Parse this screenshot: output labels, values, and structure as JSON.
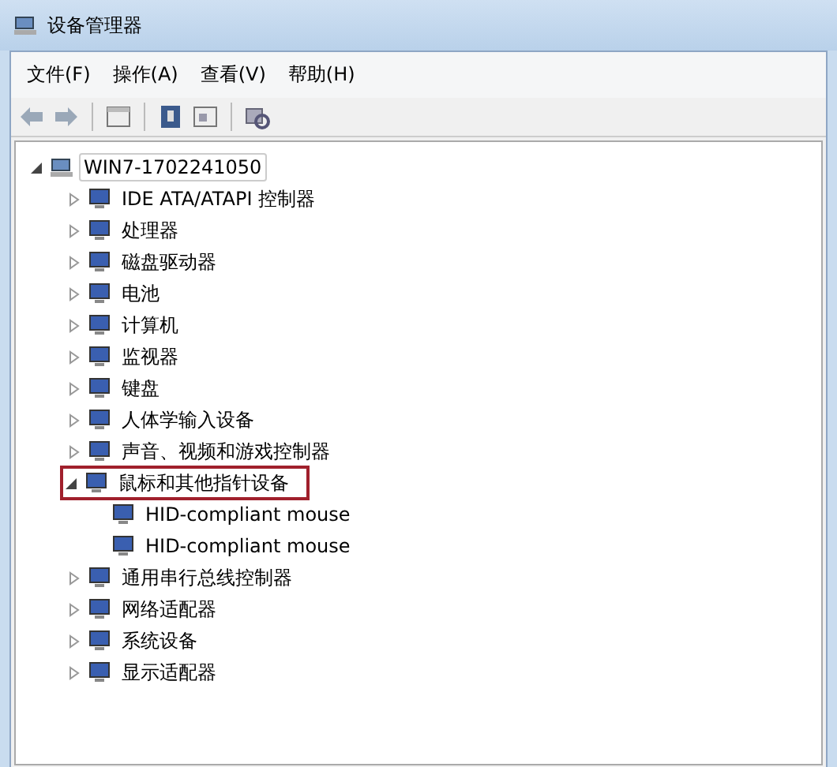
{
  "window": {
    "title": "设备管理器"
  },
  "menu": [
    "文件(F)",
    "操作(A)",
    "查看(V)",
    "帮助(H)"
  ],
  "tree": {
    "label": "WIN7-1702241050",
    "expanded": true,
    "selected": true,
    "children": [
      {
        "label": "IDE ATA/ATAPI 控制器",
        "expanded": false,
        "highlighted": false
      },
      {
        "label": "处理器",
        "expanded": false,
        "highlighted": false
      },
      {
        "label": "磁盘驱动器",
        "expanded": false,
        "highlighted": false
      },
      {
        "label": "电池",
        "expanded": false,
        "highlighted": false
      },
      {
        "label": "计算机",
        "expanded": false,
        "highlighted": false
      },
      {
        "label": "监视器",
        "expanded": false,
        "highlighted": false
      },
      {
        "label": "键盘",
        "expanded": false,
        "highlighted": false
      },
      {
        "label": "人体学输入设备",
        "expanded": false,
        "highlighted": false
      },
      {
        "label": "声音、视频和游戏控制器",
        "expanded": false,
        "highlighted": false
      },
      {
        "label": "鼠标和其他指针设备",
        "expanded": true,
        "highlighted": true,
        "children": [
          {
            "label": "HID-compliant mouse"
          },
          {
            "label": "HID-compliant mouse"
          }
        ]
      },
      {
        "label": "通用串行总线控制器",
        "expanded": false,
        "highlighted": false
      },
      {
        "label": "网络适配器",
        "expanded": false,
        "highlighted": false
      },
      {
        "label": "系统设备",
        "expanded": false,
        "highlighted": false
      },
      {
        "label": "显示适配器",
        "expanded": false,
        "highlighted": false
      }
    ]
  }
}
